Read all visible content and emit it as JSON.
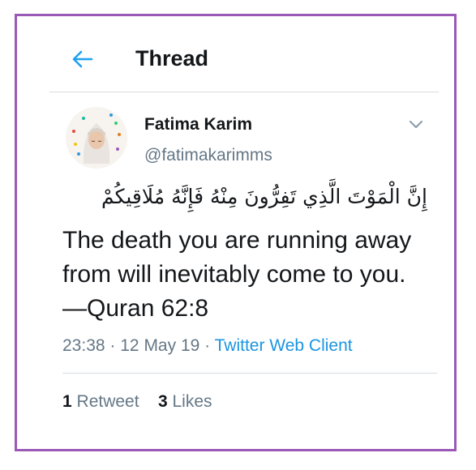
{
  "header": {
    "title": "Thread",
    "back_icon": "arrow-left-icon",
    "accent": "#1da1f2"
  },
  "tweet": {
    "author_name": "Fatima Karim",
    "author_handle": "@fatimakarimms",
    "arabic_text": "إِنَّ الْمَوْتَ الَّذِي تَفِرُّونَ مِنْهُ فَإِنَّهُ مُلَاقِيكُمْ",
    "text": "The death you are running away from will inevitably come to you. —Quran 62:8",
    "time": "23:38",
    "separator": "·",
    "date": "12 May 19",
    "client": "Twitter Web Client",
    "retweet_count": "1",
    "retweet_label": "Retweet",
    "like_count": "3",
    "like_label": "Likes"
  },
  "colors": {
    "frame_border": "#9b59b6",
    "link": "#1b95e0",
    "secondary_text": "#657786"
  }
}
